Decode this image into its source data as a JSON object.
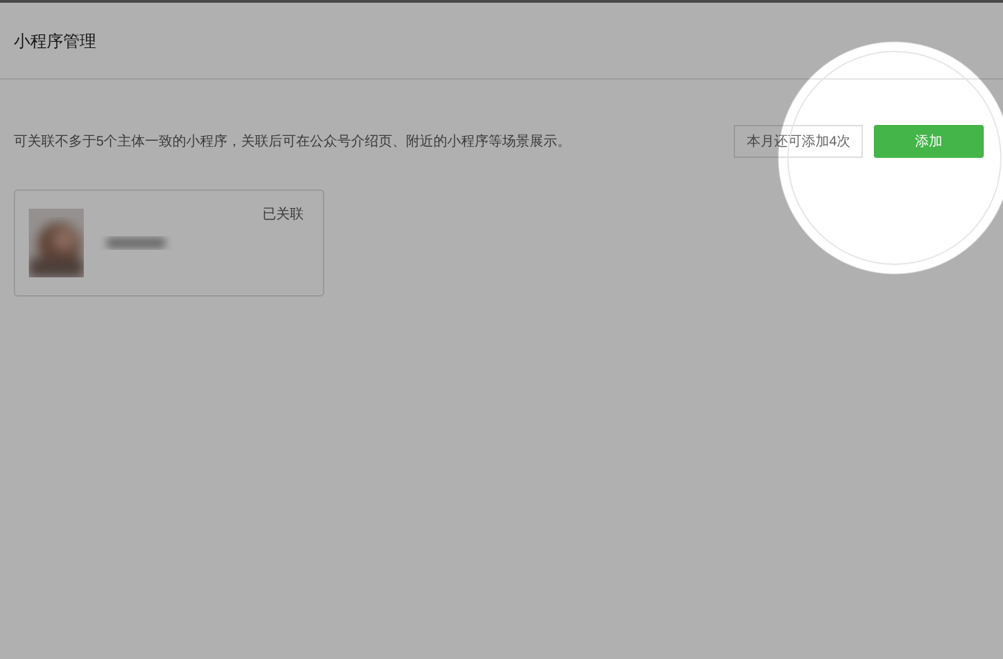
{
  "header": {
    "title": "小程序管理"
  },
  "description": "可关联不多于5个主体一致的小程序，关联后可在公众号介绍页、附近的小程序等场景展示。",
  "quota_tip": "本月还可添加4次",
  "add_button": "添加",
  "mini_programs": [
    {
      "kind": "picture",
      "status": "已关联"
    }
  ]
}
